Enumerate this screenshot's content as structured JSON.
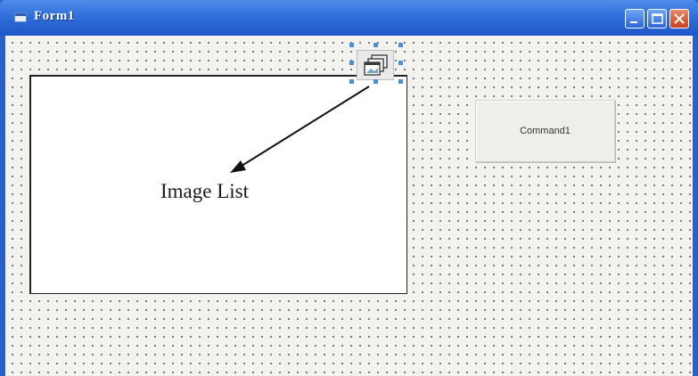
{
  "window": {
    "title": "Form1"
  },
  "controls": {
    "command_button_label": "Command1",
    "imagelist_icon": "imagelist-icon"
  },
  "annotation": {
    "label": "Image List"
  },
  "colors": {
    "titlebar": "#2f6fdc",
    "close_button": "#c9401c",
    "selection_handle": "#4b8fd6"
  }
}
